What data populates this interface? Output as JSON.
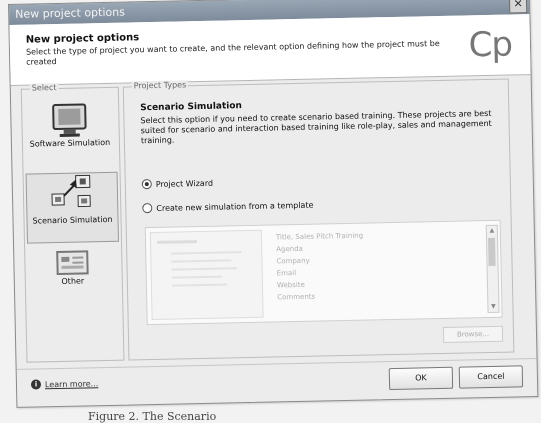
{
  "window": {
    "title": "New project options",
    "close_glyph": "✕"
  },
  "header": {
    "title": "New project options",
    "description": "Select the type of project you want to create, and the relevant option defining how the project must be created",
    "logo": "Cp"
  },
  "select_panel": {
    "label": "Select",
    "items": [
      {
        "label": "Software Simulation",
        "icon": "monitor-icon"
      },
      {
        "label": "Scenario Simulation",
        "icon": "scenario-icon"
      },
      {
        "label": "Other",
        "icon": "other-icon"
      }
    ]
  },
  "project_types": {
    "label": "Project Types",
    "title": "Scenario Simulation",
    "description": "Select this option if you need to create scenario based training. These projects are best suited for scenario and interaction based training like role-play, sales and management training.",
    "options": [
      {
        "label": "Project Wizard",
        "checked": true
      },
      {
        "label": "Create new simulation from a template",
        "checked": false
      }
    ],
    "template_items": [
      "Title, Sales Pitch Training",
      "Agenda",
      "Company",
      "Email",
      "Website",
      "Comments"
    ],
    "browse_label": "Browse..."
  },
  "footer": {
    "learn_more": "Learn more...",
    "ok_label": "OK",
    "cancel_label": "Cancel"
  },
  "caption": "Figure 2. The Scenario"
}
